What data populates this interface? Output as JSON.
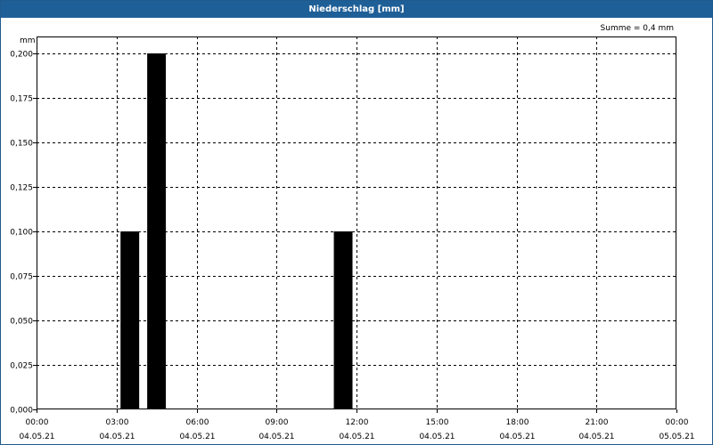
{
  "window": {
    "title": "Niederschlag [mm]"
  },
  "chart_data": {
    "type": "bar",
    "title": "Niederschlag [mm]",
    "ylabel": "mm",
    "annotation": "Summe = 0,4 mm",
    "xlim": [
      "04.05.21 00:00",
      "05.05.21 00:00"
    ],
    "ylim": [
      0,
      0.2
    ],
    "grid": true,
    "bar_color": "#000000",
    "x_ticks": [
      {
        "time": "00:00",
        "date": "04.05.21"
      },
      {
        "time": "03:00",
        "date": "04.05.21"
      },
      {
        "time": "06:00",
        "date": "04.05.21"
      },
      {
        "time": "09:00",
        "date": "04.05.21"
      },
      {
        "time": "12:00",
        "date": "04.05.21"
      },
      {
        "time": "15:00",
        "date": "04.05.21"
      },
      {
        "time": "18:00",
        "date": "04.05.21"
      },
      {
        "time": "21:00",
        "date": "04.05.21"
      },
      {
        "time": "00:00",
        "date": "05.05.21"
      }
    ],
    "y_ticks": [
      "0,000",
      "0,025",
      "0,050",
      "0,075",
      "0,100",
      "0,125",
      "0,150",
      "0,175",
      "0,200"
    ],
    "bars": [
      {
        "start": "04.05.21 03:00",
        "end": "04.05.21 04:00",
        "value": 0.1
      },
      {
        "start": "04.05.21 04:00",
        "end": "04.05.21 05:00",
        "value": 0.2
      },
      {
        "start": "04.05.21 11:00",
        "end": "04.05.21 12:00",
        "value": 0.1
      }
    ]
  }
}
